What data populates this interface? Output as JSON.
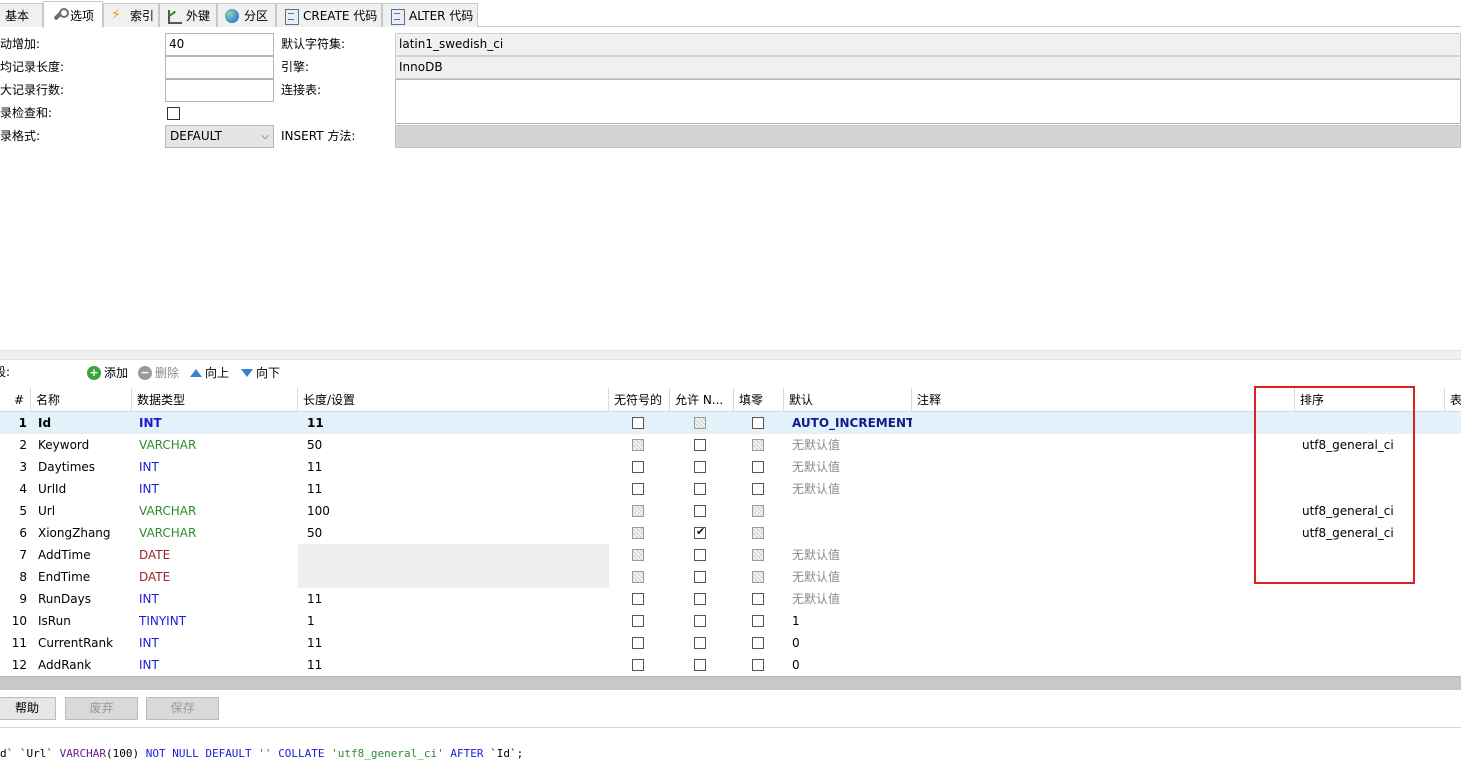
{
  "tabs": [
    {
      "label": "基本",
      "icon": "none"
    },
    {
      "label": "选项",
      "icon": "wrench-icon",
      "active": true
    },
    {
      "label": "索引",
      "icon": "lightning-icon"
    },
    {
      "label": "外键",
      "icon": "chart-icon"
    },
    {
      "label": "分区",
      "icon": "globe-icon"
    },
    {
      "label": "CREATE 代码",
      "icon": "document-icon"
    },
    {
      "label": "ALTER 代码",
      "icon": "document-icon"
    }
  ],
  "options": {
    "auto_increment_label": "自动增加:",
    "auto_increment_value": "40",
    "avg_row_length_label": "平均记录长度:",
    "avg_row_length_value": "",
    "max_rows_label": "最大记录行数:",
    "max_rows_value": "",
    "checksum_label": "记录检查和:",
    "row_format_label": "记录格式:",
    "row_format_value": "DEFAULT",
    "charset_label": "默认字符集:",
    "charset_value": "latin1_swedish_ci",
    "engine_label": "引擎:",
    "engine_value": "InnoDB",
    "union_label": "连接表:",
    "union_value": "",
    "insert_method_label": "INSERT 方法:",
    "insert_method_value": ""
  },
  "toolbar": {
    "fields_label": "段:",
    "add": "添加",
    "delete": "删除",
    "up": "向上",
    "down": "向下"
  },
  "columns": {
    "num": "#",
    "name": "名称",
    "type": "数据类型",
    "length": "长度/设置",
    "unsigned": "无符号的",
    "nullable": "允许 N...",
    "zerofill": "填零",
    "default": "默认",
    "comment": "注释",
    "collation": "排序",
    "extra": "表"
  },
  "rows": [
    {
      "num": "1",
      "name": "Id",
      "type": "INT",
      "length": "11",
      "default": "AUTO_INCREMENT",
      "collation": "",
      "nullable": false
    },
    {
      "num": "2",
      "name": "Keyword",
      "type": "VARCHAR",
      "length": "50",
      "default": "无默认值",
      "collation": "utf8_general_ci",
      "nullable": false
    },
    {
      "num": "3",
      "name": "Daytimes",
      "type": "INT",
      "length": "11",
      "default": "无默认值",
      "collation": "",
      "nullable": false
    },
    {
      "num": "4",
      "name": "UrlId",
      "type": "INT",
      "length": "11",
      "default": "无默认值",
      "collation": "",
      "nullable": false
    },
    {
      "num": "5",
      "name": "Url",
      "type": "VARCHAR",
      "length": "100",
      "default": "",
      "collation": "utf8_general_ci",
      "nullable": false
    },
    {
      "num": "6",
      "name": "XiongZhang",
      "type": "VARCHAR",
      "length": "50",
      "default": "",
      "collation": "utf8_general_ci",
      "nullable": true
    },
    {
      "num": "7",
      "name": "AddTime",
      "type": "DATE",
      "length": "",
      "default": "无默认值",
      "collation": "",
      "nullable": false
    },
    {
      "num": "8",
      "name": "EndTime",
      "type": "DATE",
      "length": "",
      "default": "无默认值",
      "collation": "",
      "nullable": false
    },
    {
      "num": "9",
      "name": "RunDays",
      "type": "INT",
      "length": "11",
      "default": "无默认值",
      "collation": "",
      "nullable": false
    },
    {
      "num": "10",
      "name": "IsRun",
      "type": "TINYINT",
      "length": "1",
      "default": "1",
      "collation": "",
      "nullable": false
    },
    {
      "num": "11",
      "name": "CurrentRank",
      "type": "INT",
      "length": "11",
      "default": "0",
      "collation": "",
      "nullable": false
    },
    {
      "num": "12",
      "name": "AddRank",
      "type": "INT",
      "length": "11",
      "default": "0",
      "collation": "",
      "nullable": false
    }
  ],
  "buttons": {
    "help": "帮助",
    "discard": "废弃",
    "save": "保存"
  },
  "sql": {
    "part1": "d` `Url` ",
    "kw1": "VARCHAR",
    "part2": "(100) ",
    "kw2": "NOT NULL DEFAULT",
    "str1": " '' ",
    "kw3": "COLLATE",
    "str2": " 'utf8_general_ci' ",
    "kw4": "AFTER",
    "part3": " `Id`;"
  },
  "colors": {
    "type_int": "#1a1adc",
    "type_varchar": "#2f8a2f",
    "type_date": "#9a2525",
    "highlight": "#e02020",
    "selected_row": "#e3f1fb"
  }
}
